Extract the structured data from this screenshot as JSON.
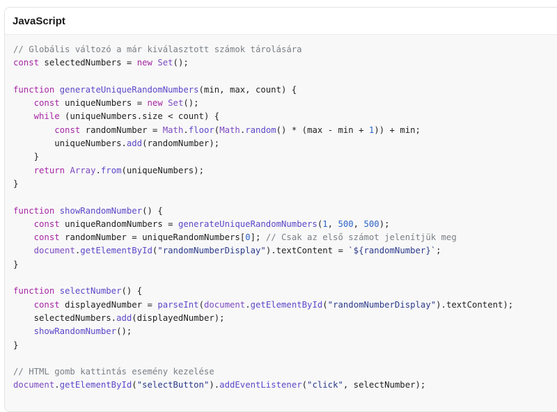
{
  "code_block": {
    "language": "JavaScript",
    "colors": {
      "comment": "#7a7f85",
      "keyword": "#a626a4",
      "function": "#5c47c8",
      "builtin": "#7c4ac0",
      "number": "#2a63c9",
      "string": "#2b3a8a",
      "plain": "#1f1f1f"
    },
    "lines": [
      [
        [
          "c",
          "// Globális változó a már kiválasztott számok tárolására"
        ]
      ],
      [
        [
          "k",
          "const"
        ],
        [
          "p",
          " selectedNumbers = "
        ],
        [
          "k",
          "new"
        ],
        [
          "p",
          " "
        ],
        [
          "b",
          "Set"
        ],
        [
          "p",
          "();"
        ]
      ],
      [],
      [
        [
          "k",
          "function"
        ],
        [
          "p",
          " "
        ],
        [
          "f",
          "generateUniqueRandomNumbers"
        ],
        [
          "p",
          "(min, max, count) {"
        ]
      ],
      [
        [
          "p",
          "    "
        ],
        [
          "k",
          "const"
        ],
        [
          "p",
          " uniqueNumbers = "
        ],
        [
          "k",
          "new"
        ],
        [
          "p",
          " "
        ],
        [
          "b",
          "Set"
        ],
        [
          "p",
          "();"
        ]
      ],
      [
        [
          "p",
          "    "
        ],
        [
          "k",
          "while"
        ],
        [
          "p",
          " (uniqueNumbers.size < count) {"
        ]
      ],
      [
        [
          "p",
          "        "
        ],
        [
          "k",
          "const"
        ],
        [
          "p",
          " randomNumber = "
        ],
        [
          "b",
          "Math"
        ],
        [
          "p",
          "."
        ],
        [
          "f",
          "floor"
        ],
        [
          "p",
          "("
        ],
        [
          "b",
          "Math"
        ],
        [
          "p",
          "."
        ],
        [
          "f",
          "random"
        ],
        [
          "p",
          "() * (max - min + "
        ],
        [
          "n",
          "1"
        ],
        [
          "p",
          ")) + min;"
        ]
      ],
      [
        [
          "p",
          "        uniqueNumbers."
        ],
        [
          "f",
          "add"
        ],
        [
          "p",
          "(randomNumber);"
        ]
      ],
      [
        [
          "p",
          "    }"
        ]
      ],
      [
        [
          "p",
          "    "
        ],
        [
          "k",
          "return"
        ],
        [
          "p",
          " "
        ],
        [
          "b",
          "Array"
        ],
        [
          "p",
          "."
        ],
        [
          "f",
          "from"
        ],
        [
          "p",
          "(uniqueNumbers);"
        ]
      ],
      [
        [
          "p",
          "}"
        ]
      ],
      [],
      [
        [
          "k",
          "function"
        ],
        [
          "p",
          " "
        ],
        [
          "f",
          "showRandomNumber"
        ],
        [
          "p",
          "() {"
        ]
      ],
      [
        [
          "p",
          "    "
        ],
        [
          "k",
          "const"
        ],
        [
          "p",
          " uniqueRandomNumbers = "
        ],
        [
          "f",
          "generateUniqueRandomNumbers"
        ],
        [
          "p",
          "("
        ],
        [
          "n",
          "1"
        ],
        [
          "p",
          ", "
        ],
        [
          "n",
          "500"
        ],
        [
          "p",
          ", "
        ],
        [
          "n",
          "500"
        ],
        [
          "p",
          ");"
        ]
      ],
      [
        [
          "p",
          "    "
        ],
        [
          "k",
          "const"
        ],
        [
          "p",
          " randomNumber = uniqueRandomNumbers["
        ],
        [
          "n",
          "0"
        ],
        [
          "p",
          "]; "
        ],
        [
          "c",
          "// Csak az első számot jelenítjük meg"
        ]
      ],
      [
        [
          "p",
          "    "
        ],
        [
          "b",
          "document"
        ],
        [
          "p",
          "."
        ],
        [
          "f",
          "getElementById"
        ],
        [
          "p",
          "("
        ],
        [
          "s",
          "\"randomNumberDisplay\""
        ],
        [
          "p",
          ").textContent = "
        ],
        [
          "s",
          "`${randomNumber}`"
        ],
        [
          "p",
          ";"
        ]
      ],
      [
        [
          "p",
          "}"
        ]
      ],
      [],
      [
        [
          "k",
          "function"
        ],
        [
          "p",
          " "
        ],
        [
          "f",
          "selectNumber"
        ],
        [
          "p",
          "() {"
        ]
      ],
      [
        [
          "p",
          "    "
        ],
        [
          "k",
          "const"
        ],
        [
          "p",
          " displayedNumber = "
        ],
        [
          "f",
          "parseInt"
        ],
        [
          "p",
          "("
        ],
        [
          "b",
          "document"
        ],
        [
          "p",
          "."
        ],
        [
          "f",
          "getElementById"
        ],
        [
          "p",
          "("
        ],
        [
          "s",
          "\"randomNumberDisplay\""
        ],
        [
          "p",
          ").textContent);"
        ]
      ],
      [
        [
          "p",
          "    selectedNumbers."
        ],
        [
          "f",
          "add"
        ],
        [
          "p",
          "(displayedNumber);"
        ]
      ],
      [
        [
          "p",
          "    "
        ],
        [
          "f",
          "showRandomNumber"
        ],
        [
          "p",
          "();"
        ]
      ],
      [
        [
          "p",
          "}"
        ]
      ],
      [],
      [
        [
          "c",
          "// HTML gomb kattintás esemény kezelése"
        ]
      ],
      [
        [
          "b",
          "document"
        ],
        [
          "p",
          "."
        ],
        [
          "f",
          "getElementById"
        ],
        [
          "p",
          "("
        ],
        [
          "s",
          "\"selectButton\""
        ],
        [
          "p",
          ")."
        ],
        [
          "f",
          "addEventListener"
        ],
        [
          "p",
          "("
        ],
        [
          "s",
          "\"click\""
        ],
        [
          "p",
          ", selectNumber);"
        ]
      ]
    ]
  }
}
